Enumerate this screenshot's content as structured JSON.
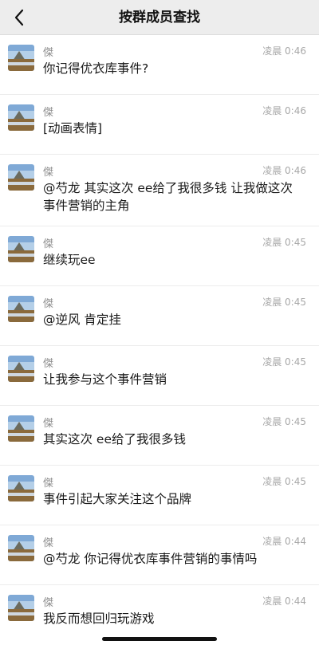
{
  "header": {
    "title": "按群成员查找"
  },
  "messages": [
    {
      "sender": "傑",
      "time": "凌晨 0:46",
      "text": "你记得优衣库事件?"
    },
    {
      "sender": "傑",
      "time": "凌晨 0:46",
      "text": "[动画表情]"
    },
    {
      "sender": "傑",
      "time": "凌晨 0:46",
      "text": "@芍龙 其实这次 ee给了我很多钱 让我做这次事件营销的主角"
    },
    {
      "sender": "傑",
      "time": "凌晨 0:45",
      "text": "继续玩ee"
    },
    {
      "sender": "傑",
      "time": "凌晨 0:45",
      "text": "@逆风 肯定挂"
    },
    {
      "sender": "傑",
      "time": "凌晨 0:45",
      "text": "让我参与这个事件营销"
    },
    {
      "sender": "傑",
      "time": "凌晨 0:45",
      "text": "其实这次 ee给了我很多钱"
    },
    {
      "sender": "傑",
      "time": "凌晨 0:45",
      "text": "事件引起大家关注这个品牌"
    },
    {
      "sender": "傑",
      "time": "凌晨 0:44",
      "text": "@芍龙 你记得优衣库事件营销的事情吗"
    },
    {
      "sender": "傑",
      "time": "凌晨 0:44",
      "text": "我反而想回归玩游戏"
    }
  ]
}
